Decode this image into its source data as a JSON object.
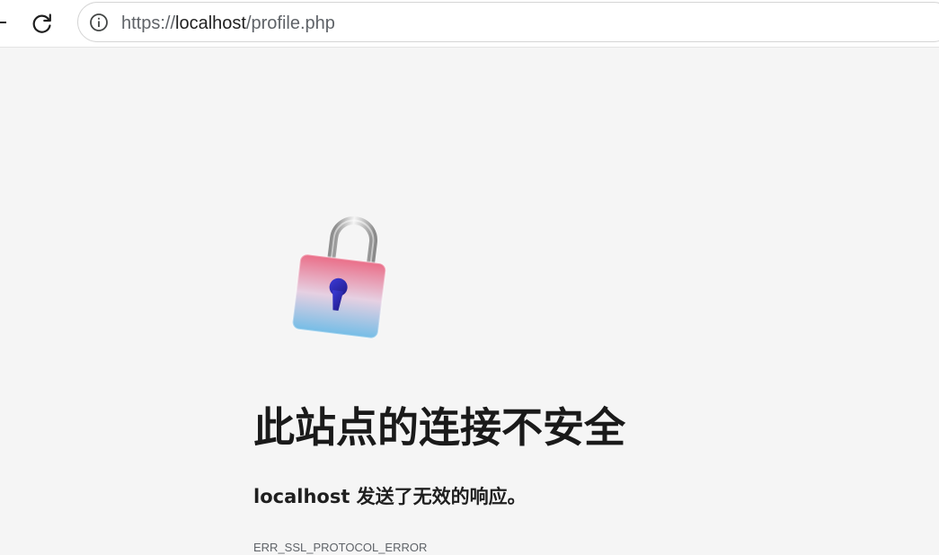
{
  "browser": {
    "url": {
      "scheme": "https://",
      "host": "localhost",
      "path": "/profile.php"
    },
    "icons": {
      "reload": "reload-icon",
      "site_info": "info-circle-icon"
    }
  },
  "error_page": {
    "icon": "unlocked-padlock-icon",
    "heading": "此站点的连接不安全",
    "description_host": "localhost",
    "description_rest": " 发送了无效的响应。",
    "error_code": "ERR_SSL_PROTOCOL_ERROR"
  }
}
